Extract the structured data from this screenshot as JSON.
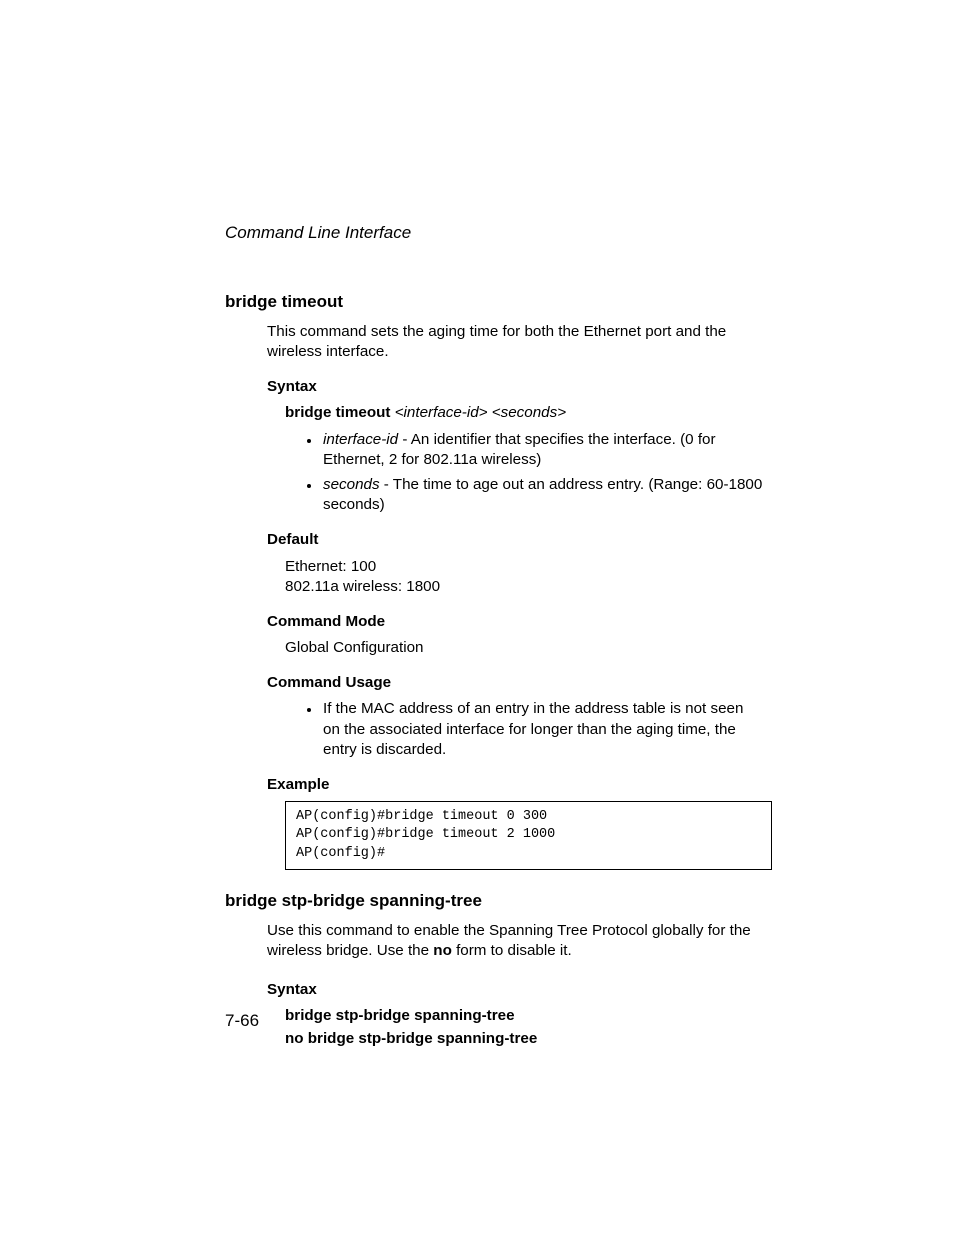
{
  "running_head": "Command Line Interface",
  "section1": {
    "title": "bridge timeout",
    "intro": "This command sets the aging time for both the Ethernet port and the wireless interface.",
    "syntax_head": "Syntax",
    "syntax_cmd": "bridge timeout",
    "syntax_args": " <interface-id> <seconds>",
    "param1_name": "interface-id",
    "param1_desc": " - An identifier that specifies the interface. (0 for Ethernet, 2 for 802.11a wireless)",
    "param2_name": "seconds",
    "param2_desc": " - The time to age out an address entry. (Range: 60-1800 seconds)",
    "default_head": "Default",
    "default_l1": "Ethernet: 100",
    "default_l2": "802.11a wireless: 1800",
    "mode_head": "Command Mode",
    "mode_body": "Global Configuration",
    "usage_head": "Command Usage",
    "usage_bullet": "If the MAC address of an entry in the address table is not seen on the associated interface for longer than the aging time, the entry is discarded.",
    "example_head": "Example",
    "example_code": "AP(config)#bridge timeout 0 300\nAP(config)#bridge timeout 2 1000\nAP(config)#"
  },
  "section2": {
    "title": "bridge stp-bridge spanning-tree",
    "intro_a": "Use this command to enable the Spanning Tree Protocol globally for the wireless bridge. Use the ",
    "intro_bold": "no",
    "intro_b": " form to disable it.",
    "syntax_head": "Syntax",
    "syntax_l1": "bridge stp-bridge spanning-tree",
    "syntax_l2": "no bridge stp-bridge spanning-tree"
  },
  "page_number": "7-66"
}
